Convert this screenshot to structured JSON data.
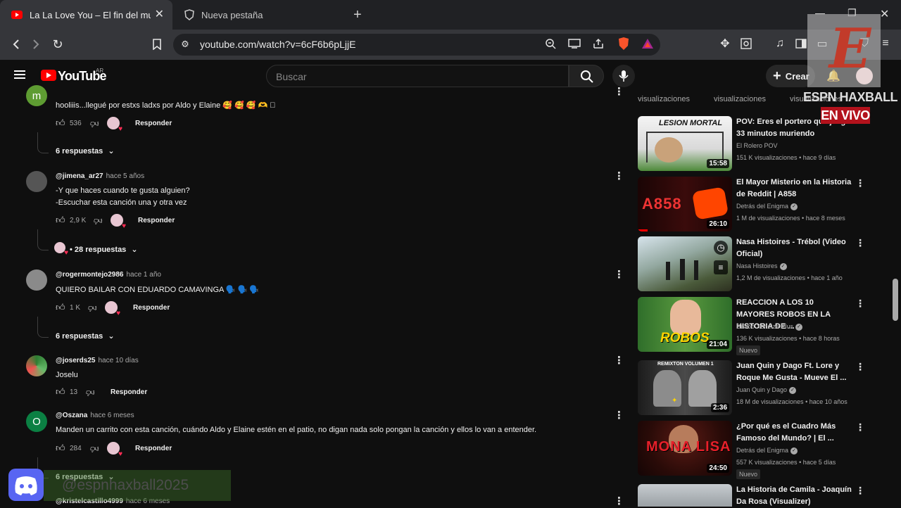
{
  "browser": {
    "tabs": [
      {
        "title": "La La Love You – El fin del mundo",
        "active": true
      },
      {
        "title": "Nueva pestaña",
        "active": false
      }
    ],
    "url": "youtube.com/watch?v=6cF6b6pLjjE",
    "brave_badge": "10"
  },
  "youtube": {
    "logo": "YouTube",
    "country": "AR",
    "search_placeholder": "Buscar",
    "create_label": "Crear"
  },
  "comments": [
    {
      "handle": "",
      "ago": "",
      "avatar_letter": "m",
      "avatar_color": "#5e9c32",
      "text": "hooliiis...llegué por estxs ladxs por Aldo y Elaine 🥰 🥰 🥰 🫶 🏻",
      "likes": "536",
      "reply": "Responder",
      "replies": "6 respuestas"
    },
    {
      "handle": "@jimena_ar27",
      "ago": "hace 5 años",
      "text_lines": [
        "-Y que haces cuando te gusta alguien?",
        "-Escuchar esta canción una y otra vez"
      ],
      "likes": "2,9 K",
      "reply": "Responder",
      "replies": "28 respuestas"
    },
    {
      "handle": "@rogermontejo2986",
      "ago": "hace 1 año",
      "text": "QUIERO BAILAR CON EDUARDO CAMAVINGA 🗣️ 🗣️ 🗣️",
      "likes": "1 K",
      "reply": "Responder",
      "replies": "6 respuestas"
    },
    {
      "handle": "@joserds25",
      "ago": "hace 10 días",
      "text": "Joselu",
      "likes": "13",
      "reply": "Responder"
    },
    {
      "handle": "@Oszana",
      "ago": "hace 6 meses",
      "avatar_letter": "O",
      "avatar_color": "#0b8043",
      "text": "Manden un carrito con esta canción, cuándo Aldo y Elaine estén en el patio, no digan nada solo pongan la canción y ellos lo van a entender.",
      "likes": "284",
      "reply": "Responder",
      "replies": "6 respuestas"
    },
    {
      "handle": "@kristelcastillo4999",
      "ago": "hace 6 meses"
    }
  ],
  "sidebar": {
    "top_views": [
      "visualizaciones",
      "visualizaciones",
      "visualizaciones"
    ],
    "videos": [
      {
        "title": "POV: Eres el portero que juega 33 minutos muriendo",
        "channel": "El Rolero POV",
        "verified": false,
        "views": "151 K visualizaciones",
        "ago": "hace 9 días",
        "duration": "15:58",
        "thumb_text": "LESION MORTAL",
        "new": ""
      },
      {
        "title": "El Mayor Misterio en la Historia de Reddit | A858",
        "channel": "Detrás del Enigma",
        "verified": true,
        "views": "1 M de visualizaciones",
        "ago": "hace 8 meses",
        "duration": "26:10",
        "thumb_text": "A858",
        "new": ""
      },
      {
        "title": "Nasa Histoires - Trébol (Video Oficial)",
        "channel": "Nasa Histoires",
        "verified": true,
        "views": "1,2 M de visualizaciones",
        "ago": "hace 1 año",
        "duration": "",
        "thumb_text": "",
        "new": ""
      },
      {
        "title": "REACCION A LOS 10 MAYORES ROBOS EN LA HISTORIA DE ...",
        "channel": "Davoo Xeneize Plus",
        "verified": true,
        "views": "136 K visualizaciones",
        "ago": "hace 8 horas",
        "duration": "21:04",
        "thumb_text": "ROBOS",
        "new": "Nuevo"
      },
      {
        "title": "Juan Quin y Dago Ft. Lore y Roque Me Gusta - Mueve El ...",
        "channel": "Juan Quin y Dago",
        "verified": true,
        "views": "18 M de visualizaciones",
        "ago": "hace 10 años",
        "duration": "2:36",
        "thumb_text": "REMIXTON VOLUMEN 1",
        "new": ""
      },
      {
        "title": "¿Por qué es el Cuadro Más Famoso del Mundo? | El ...",
        "channel": "Detrás del Enigma",
        "verified": true,
        "views": "557 K visualizaciones",
        "ago": "hace 5 días",
        "duration": "24:50",
        "thumb_text": "MONA LISA",
        "new": "Nuevo"
      },
      {
        "title": "La Historia de Camila - Joaquín Da Rosa (Visualizer)",
        "channel": "",
        "verified": false,
        "views": "",
        "ago": "",
        "duration": "",
        "thumb_text": "",
        "new": ""
      }
    ]
  },
  "overlay": {
    "espn_label": "ESPN HAXBALL",
    "live": "EN VIVO",
    "discord_handle": "@espnhaxball2025"
  },
  "colors": {
    "background": "#0f0f0f",
    "youtube_red": "#ff0000",
    "live_red": "#b3121c",
    "discord": "#5865f2"
  }
}
